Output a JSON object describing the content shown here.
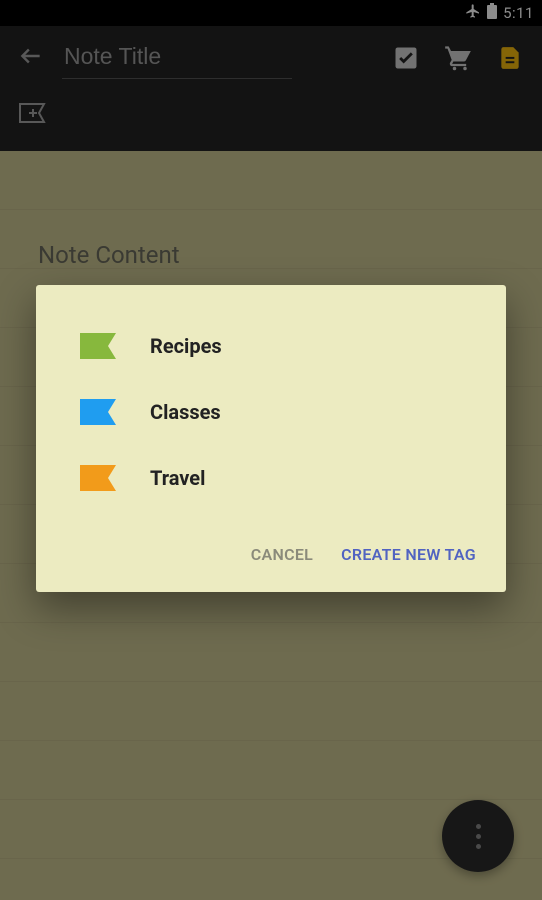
{
  "status": {
    "time": "5:11"
  },
  "header": {
    "title_placeholder": "Note Title"
  },
  "note": {
    "content_placeholder": "Note Content"
  },
  "dialog": {
    "tags": [
      {
        "label": "Recipes",
        "color": "#87b83d"
      },
      {
        "label": "Classes",
        "color": "#1f9df0"
      },
      {
        "label": "Travel",
        "color": "#f29b1a"
      }
    ],
    "cancel_label": "CANCEL",
    "create_label": "CREATE NEW TAG"
  }
}
